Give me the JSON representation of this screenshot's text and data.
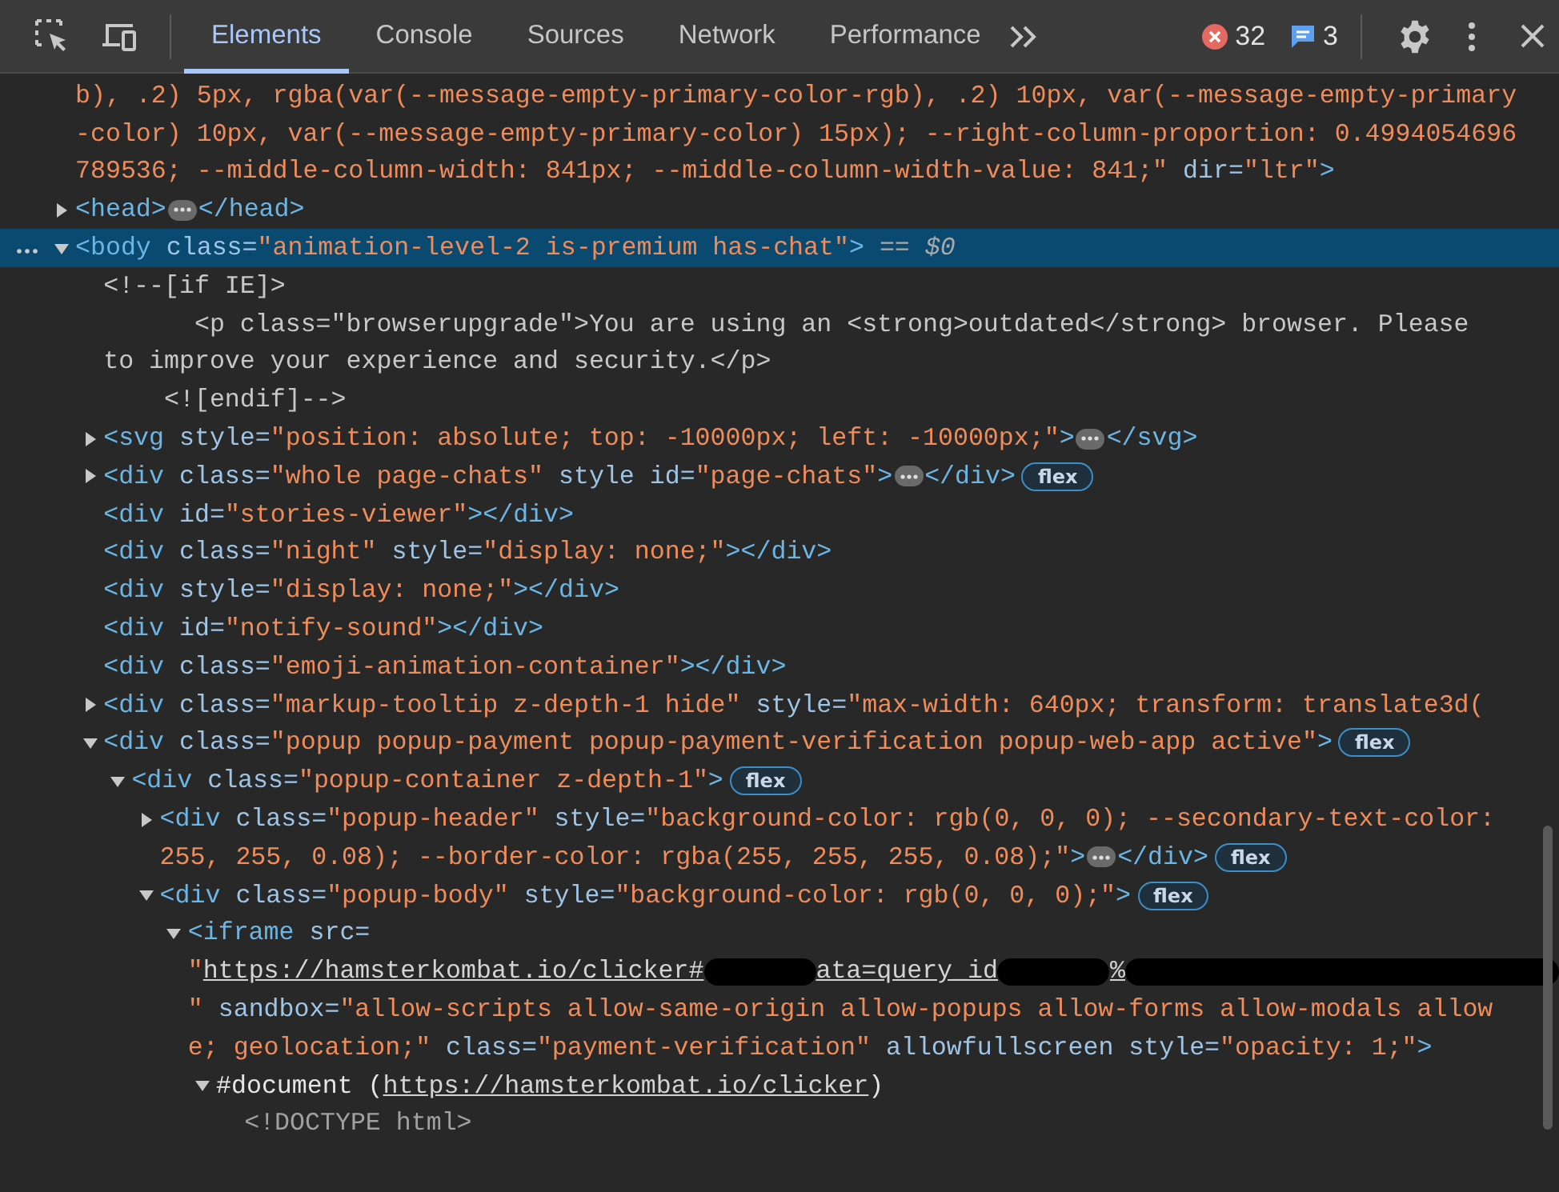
{
  "toolbar": {
    "tabs": [
      {
        "label": "Elements",
        "selected": true
      },
      {
        "label": "Console",
        "selected": false
      },
      {
        "label": "Sources",
        "selected": false
      },
      {
        "label": "Network",
        "selected": false
      },
      {
        "label": "Performance",
        "selected": false
      }
    ],
    "errors": "32",
    "messages": "3"
  },
  "tree": [
    {
      "selected": false,
      "lines": [
        [
          {
            "kind": "value",
            "text": "b), .2) 5px, rgba(var(--message-empty-primary-color-rgb), .2) 10px, var(--message-empty-primary"
          }
        ],
        [
          {
            "kind": "value",
            "text": "-color) 10px, var(--message-empty-primary-color) 15px); --right-column-proportion: 0.4994054696"
          }
        ],
        [
          {
            "kind": "value",
            "text": "789536; --middle-column-width: 841px; --middle-column-width-value: 841;\""
          },
          {
            "kind": "attr",
            "text": " dir="
          },
          {
            "kind": "value",
            "text": "\"ltr\""
          },
          {
            "kind": "tag",
            "text": ">"
          }
        ]
      ],
      "children": [
        {
          "selected": false,
          "expanded": false,
          "lines": [
            [
              {
                "kind": "tag",
                "text": "<head>"
              },
              {
                "kind": "more"
              },
              {
                "kind": "tag",
                "text": "</head>"
              }
            ]
          ]
        },
        {
          "selected": true,
          "expanded": true,
          "lines": [
            [
              {
                "kind": "tag",
                "text": "<body"
              },
              {
                "kind": "attr",
                "text": " class="
              },
              {
                "kind": "value",
                "text": "\"animation-level-2 is-premium has-chat\""
              },
              {
                "kind": "tag",
                "text": ">"
              },
              {
                "kind": "marker",
                "text": " == $0"
              }
            ]
          ],
          "children": [
            {
              "selected": false,
              "lines": [
                [
                  {
                    "kind": "comment",
                    "text": "<!--[if IE]>"
                  }
                ],
                [
                  {
                    "kind": "comment",
                    "text": "      <p class=\"browserupgrade\">You are using an <strong>outdated</strong> browser. Please"
                  }
                ],
                [
                  {
                    "kind": "comment",
                    "text": "to improve your experience and security.</p>"
                  }
                ],
                [
                  {
                    "kind": "comment",
                    "text": "    <![endif]-->"
                  }
                ]
              ]
            },
            {
              "selected": false,
              "expanded": false,
              "lines": [
                [
                  {
                    "kind": "tag",
                    "text": "<svg"
                  },
                  {
                    "kind": "attr",
                    "text": " style="
                  },
                  {
                    "kind": "value",
                    "text": "\"position: absolute; top: -10000px; left: -10000px;\""
                  },
                  {
                    "kind": "tag",
                    "text": ">"
                  },
                  {
                    "kind": "more"
                  },
                  {
                    "kind": "tag",
                    "text": "</svg>"
                  }
                ]
              ]
            },
            {
              "selected": false,
              "expanded": false,
              "lines": [
                [
                  {
                    "kind": "tag",
                    "text": "<div"
                  },
                  {
                    "kind": "attr",
                    "text": " class="
                  },
                  {
                    "kind": "value",
                    "text": "\"whole page-chats\""
                  },
                  {
                    "kind": "attr",
                    "text": " style id="
                  },
                  {
                    "kind": "value",
                    "text": "\"page-chats\""
                  },
                  {
                    "kind": "tag",
                    "text": ">"
                  },
                  {
                    "kind": "more"
                  },
                  {
                    "kind": "tag",
                    "text": "</div>"
                  },
                  {
                    "kind": "badge",
                    "text": "flex"
                  }
                ]
              ]
            },
            {
              "selected": false,
              "lines": [
                [
                  {
                    "kind": "tag",
                    "text": "<div"
                  },
                  {
                    "kind": "attr",
                    "text": " id="
                  },
                  {
                    "kind": "value",
                    "text": "\"stories-viewer\""
                  },
                  {
                    "kind": "tag",
                    "text": "></div>"
                  }
                ]
              ]
            },
            {
              "selected": false,
              "lines": [
                [
                  {
                    "kind": "tag",
                    "text": "<div"
                  },
                  {
                    "kind": "attr",
                    "text": " class="
                  },
                  {
                    "kind": "value",
                    "text": "\"night\""
                  },
                  {
                    "kind": "attr",
                    "text": " style="
                  },
                  {
                    "kind": "value",
                    "text": "\"display: none;\""
                  },
                  {
                    "kind": "tag",
                    "text": "></div>"
                  }
                ]
              ]
            },
            {
              "selected": false,
              "lines": [
                [
                  {
                    "kind": "tag",
                    "text": "<div"
                  },
                  {
                    "kind": "attr",
                    "text": " style="
                  },
                  {
                    "kind": "value",
                    "text": "\"display: none;\""
                  },
                  {
                    "kind": "tag",
                    "text": "></div>"
                  }
                ]
              ]
            },
            {
              "selected": false,
              "lines": [
                [
                  {
                    "kind": "tag",
                    "text": "<div"
                  },
                  {
                    "kind": "attr",
                    "text": " id="
                  },
                  {
                    "kind": "value",
                    "text": "\"notify-sound\""
                  },
                  {
                    "kind": "tag",
                    "text": "></div>"
                  }
                ]
              ]
            },
            {
              "selected": false,
              "lines": [
                [
                  {
                    "kind": "tag",
                    "text": "<div"
                  },
                  {
                    "kind": "attr",
                    "text": " class="
                  },
                  {
                    "kind": "value",
                    "text": "\"emoji-animation-container\""
                  },
                  {
                    "kind": "tag",
                    "text": "></div>"
                  }
                ]
              ]
            },
            {
              "selected": false,
              "expanded": false,
              "lines": [
                [
                  {
                    "kind": "tag",
                    "text": "<div"
                  },
                  {
                    "kind": "attr",
                    "text": " class="
                  },
                  {
                    "kind": "value",
                    "text": "\"markup-tooltip z-depth-1 hide\""
                  },
                  {
                    "kind": "attr",
                    "text": " style="
                  },
                  {
                    "kind": "value",
                    "text": "\"max-width: 640px; transform: translate3d("
                  }
                ]
              ]
            },
            {
              "selected": false,
              "expanded": true,
              "lines": [
                [
                  {
                    "kind": "tag",
                    "text": "<div"
                  },
                  {
                    "kind": "attr",
                    "text": " class="
                  },
                  {
                    "kind": "value",
                    "text": "\"popup popup-payment popup-payment-verification popup-web-app active\""
                  },
                  {
                    "kind": "tag",
                    "text": ">"
                  },
                  {
                    "kind": "badge",
                    "text": "flex"
                  }
                ]
              ],
              "children": [
                {
                  "selected": false,
                  "expanded": true,
                  "lines": [
                    [
                      {
                        "kind": "tag",
                        "text": "<div"
                      },
                      {
                        "kind": "attr",
                        "text": " class="
                      },
                      {
                        "kind": "value",
                        "text": "\"popup-container z-depth-1\""
                      },
                      {
                        "kind": "tag",
                        "text": ">"
                      },
                      {
                        "kind": "badge",
                        "text": "flex"
                      }
                    ]
                  ],
                  "children": [
                    {
                      "selected": false,
                      "expanded": false,
                      "lines": [
                        [
                          {
                            "kind": "tag",
                            "text": "<div"
                          },
                          {
                            "kind": "attr",
                            "text": " class="
                          },
                          {
                            "kind": "value",
                            "text": "\"popup-header\""
                          },
                          {
                            "kind": "attr",
                            "text": " style="
                          },
                          {
                            "kind": "value",
                            "text": "\"background-color: rgb(0, 0, 0); --secondary-text-color:"
                          }
                        ],
                        [
                          {
                            "kind": "value",
                            "text": "255, 255, 0.08); --border-color: rgba(255, 255, 255, 0.08);\""
                          },
                          {
                            "kind": "tag",
                            "text": ">"
                          },
                          {
                            "kind": "more"
                          },
                          {
                            "kind": "tag",
                            "text": "</div>"
                          },
                          {
                            "kind": "badge",
                            "text": "flex"
                          }
                        ]
                      ]
                    },
                    {
                      "selected": false,
                      "expanded": true,
                      "lines": [
                        [
                          {
                            "kind": "tag",
                            "text": "<div"
                          },
                          {
                            "kind": "attr",
                            "text": " class="
                          },
                          {
                            "kind": "value",
                            "text": "\"popup-body\""
                          },
                          {
                            "kind": "attr",
                            "text": " style="
                          },
                          {
                            "kind": "value",
                            "text": "\"background-color: rgb(0, 0, 0);\""
                          },
                          {
                            "kind": "tag",
                            "text": ">"
                          },
                          {
                            "kind": "badge",
                            "text": "flex"
                          }
                        ]
                      ],
                      "children": [
                        {
                          "selected": false,
                          "expanded": true,
                          "lines": [
                            [
                              {
                                "kind": "tag",
                                "text": "<iframe"
                              },
                              {
                                "kind": "attr",
                                "text": " src="
                              }
                            ],
                            [
                              {
                                "kind": "value",
                                "text": "\""
                              },
                              {
                                "kind": "link",
                                "text": "https://hamsterkombat.io/clicker#"
                              },
                              {
                                "kind": "redaction"
                              },
                              {
                                "kind": "link",
                                "text": "ata=query_id"
                              },
                              {
                                "kind": "redaction"
                              },
                              {
                                "kind": "link",
                                "text": "%"
                              },
                              {
                                "kind": "redaction"
                              }
                            ],
                            [
                              {
                                "kind": "value",
                                "text": "\""
                              },
                              {
                                "kind": "attr",
                                "text": " sandbox="
                              },
                              {
                                "kind": "value",
                                "text": "\"allow-scripts allow-same-origin allow-popups allow-forms allow-modals allow"
                              }
                            ],
                            [
                              {
                                "kind": "value",
                                "text": "e; geolocation;\""
                              },
                              {
                                "kind": "attr",
                                "text": " class="
                              },
                              {
                                "kind": "value",
                                "text": "\"payment-verification\""
                              },
                              {
                                "kind": "attr",
                                "text": " allowfullscreen style="
                              },
                              {
                                "kind": "value",
                                "text": "\"opacity: 1;\""
                              },
                              {
                                "kind": "tag",
                                "text": ">"
                              }
                            ]
                          ],
                          "children": [
                            {
                              "selected": false,
                              "expanded": true,
                              "lines": [
                                [
                                  {
                                    "kind": "text",
                                    "text": "#document ("
                                  },
                                  {
                                    "kind": "link",
                                    "text": "https://hamsterkombat.io/clicker"
                                  },
                                  {
                                    "kind": "text",
                                    "text": ")"
                                  }
                                ]
                              ],
                              "children": [
                                {
                                  "selected": false,
                                  "lines": [
                                    [
                                      {
                                        "kind": "doctype",
                                        "text": "<!DOCTYPE html>"
                                      }
                                    ]
                                  ]
                                }
                              ]
                            }
                          ]
                        }
                      ]
                    }
                  ]
                }
              ]
            }
          ]
        }
      ]
    }
  ]
}
